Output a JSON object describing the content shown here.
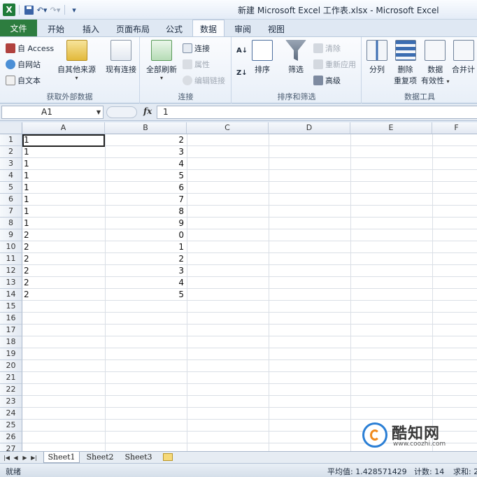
{
  "titlebar": {
    "title": "新建 Microsoft Excel 工作表.xlsx  -  Microsoft Excel",
    "logo": "X"
  },
  "tabs": [
    "文件",
    "开始",
    "插入",
    "页面布局",
    "公式",
    "数据",
    "审阅",
    "视图"
  ],
  "active_tab": "数据",
  "ribbon": {
    "external": {
      "label": "获取外部数据",
      "from_access": "自 Access",
      "from_web": "自网站",
      "from_text": "自文本",
      "from_other": "自其他来源",
      "existing": "现有连接"
    },
    "connections": {
      "label": "连接",
      "refresh_all": "全部刷新",
      "connections": "连接",
      "properties": "属性",
      "edit_links": "编辑链接"
    },
    "sort_filter": {
      "label": "排序和筛选",
      "sort": "排序",
      "filter": "筛选",
      "clear": "清除",
      "reapply": "重新应用",
      "advanced": "高级"
    },
    "data_tools": {
      "label": "数据工具",
      "split": "分列",
      "remove_dup_1": "删除",
      "remove_dup_2": "重复项",
      "validation_1": "数据",
      "validation_2": "有效性",
      "consolidate": "合并计"
    }
  },
  "formula_bar": {
    "name_box": "A1",
    "fx": "fx",
    "value": "1"
  },
  "columns": [
    "A",
    "B",
    "C",
    "D",
    "E",
    "F"
  ],
  "rows": [
    "1",
    "2",
    "3",
    "4",
    "5",
    "6",
    "7",
    "8",
    "9",
    "10",
    "11",
    "12",
    "13",
    "14",
    "15",
    "16",
    "17",
    "18",
    "19",
    "20",
    "21",
    "22",
    "23",
    "24",
    "25",
    "26",
    "27"
  ],
  "cells": {
    "A": [
      "1",
      "1",
      "1",
      "1",
      "1",
      "1",
      "1",
      "1",
      "2",
      "2",
      "2",
      "2",
      "2",
      "2"
    ],
    "B": [
      "2",
      "3",
      "4",
      "5",
      "6",
      "7",
      "8",
      "9",
      "0",
      "1",
      "2",
      "3",
      "4",
      "5"
    ]
  },
  "sheets": [
    "Sheet1",
    "Sheet2",
    "Sheet3"
  ],
  "active_sheet": "Sheet1",
  "status": {
    "ready": "就绪",
    "average": "平均值: 1.428571429",
    "count": "计数: 14",
    "sum": "求和: 2"
  },
  "watermark": {
    "title": "酷知网",
    "sub": "www.coozhi.com"
  }
}
